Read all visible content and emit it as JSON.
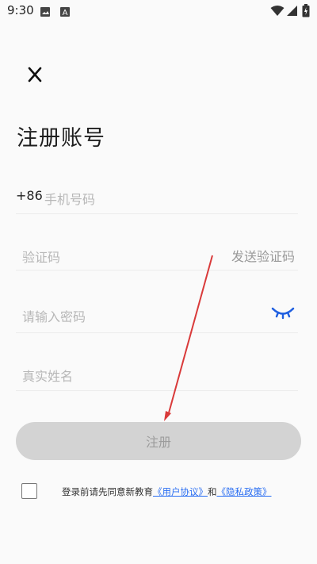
{
  "statusbar": {
    "time": "9:30"
  },
  "page": {
    "title": "注册账号"
  },
  "phone": {
    "country_code": "+86",
    "placeholder": "手机号码"
  },
  "code": {
    "placeholder": "验证码",
    "send_label": "发送验证码"
  },
  "password": {
    "placeholder": "请输入密码"
  },
  "realname": {
    "placeholder": "真实姓名"
  },
  "register_button": {
    "label": "注册"
  },
  "agreement": {
    "prefix": "登录前请先同意新教育",
    "user_agreement": "《用户协议》",
    "conjunction": "和",
    "privacy_policy": "《隐私政策》"
  },
  "colors": {
    "accent": "#2a6ef2",
    "annotation_arrow": "#d93a3a",
    "button_disabled": "#d3d3d3"
  }
}
